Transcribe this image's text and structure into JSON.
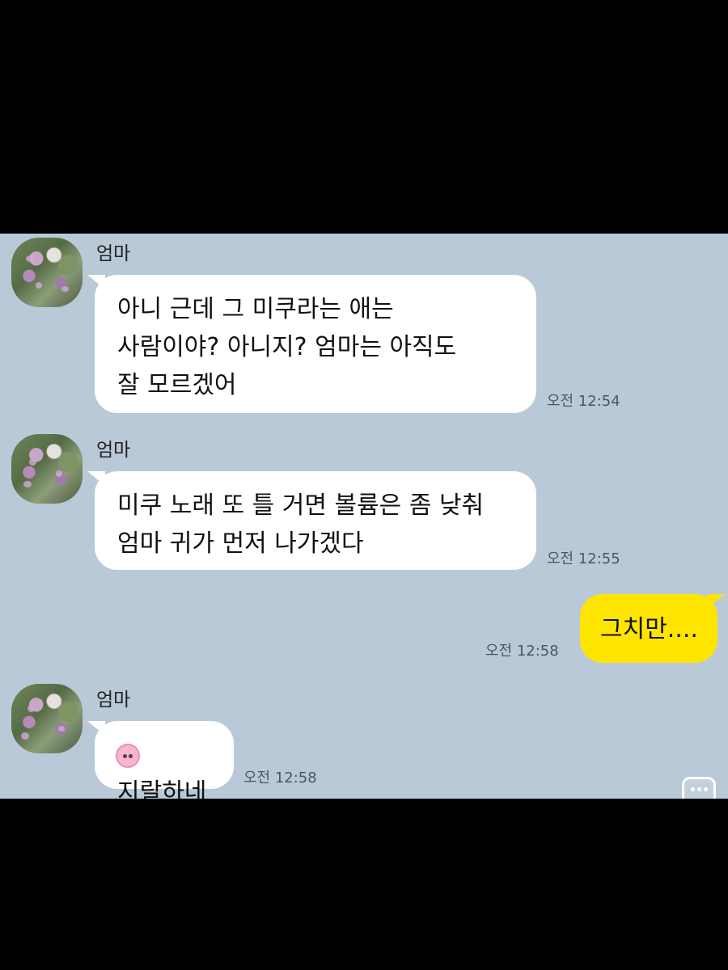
{
  "chat": {
    "messages": [
      {
        "sender": "엄마",
        "text": "아니 근데 그 미쿠라는 애는\n사람이야? 아니지? 엄마는 아직도\n잘 모르겠어",
        "time": "오전 12:54"
      },
      {
        "sender": "엄마",
        "text": "미쿠 노래 또 틀 거면 볼륨은 좀 낮춰\n엄마 귀가 먼저 나가겠다",
        "time": "오전 12:55"
      },
      {
        "sender": "me",
        "text": "그치만....",
        "time": "오전 12:58"
      },
      {
        "sender": "엄마",
        "text": "지랄하네",
        "time": "오전 12:58"
      }
    ]
  },
  "colors": {
    "chat_background": "#bac9d8",
    "incoming_bubble": "#ffffff",
    "outgoing_bubble": "#fee500",
    "letterbox": "#000000"
  },
  "icons": {
    "avatar": "profile-photo-flowers",
    "sticker": "pink-censor-blob",
    "menu": "chat-menu-icon"
  }
}
